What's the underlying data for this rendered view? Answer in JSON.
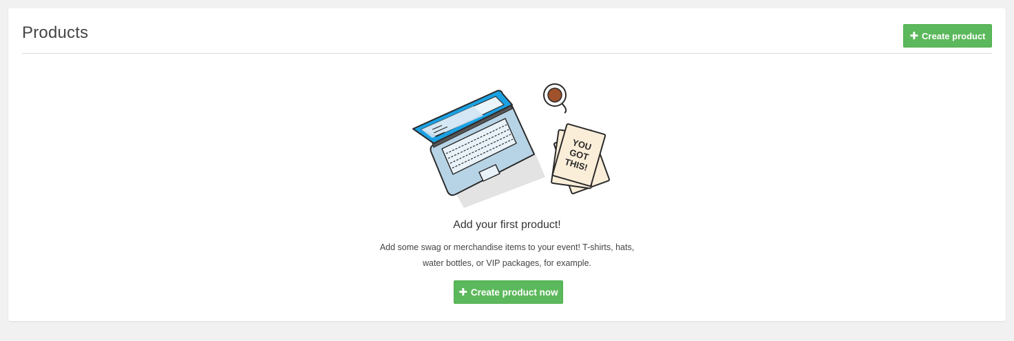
{
  "header": {
    "title": "Products",
    "create_button_label": "Create product",
    "create_button_icon": "plus-icon"
  },
  "empty_state": {
    "illustration": "laptop-coffee-notes-illustration",
    "note_text": [
      "YOU",
      "GOT",
      "THIS!"
    ],
    "title": "Add your first product!",
    "description": "Add some swag or merchandise items to your event! T-shirts, hats, water bottles, or VIP packages, for example.",
    "button_label": "Create product now",
    "button_icon": "plus-icon"
  },
  "colors": {
    "accent_green": "#5cb85c",
    "laptop_screen_blue": "#1ba1e2",
    "laptop_body": "#b7d4e6",
    "note_paper": "#fbeed9",
    "coffee": "#a0522d"
  }
}
